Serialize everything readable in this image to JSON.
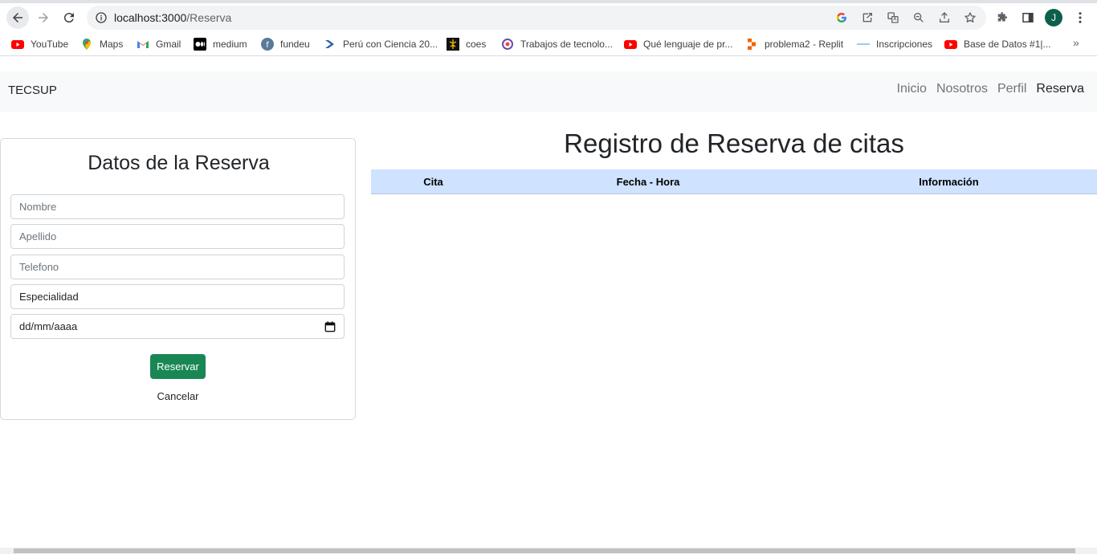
{
  "browser": {
    "url_host": "localhost:3000",
    "url_path": "/Reserva",
    "avatar_initial": "J",
    "bookmarks": [
      {
        "label": "YouTube",
        "icon": "youtube-icon"
      },
      {
        "label": "Maps",
        "icon": "maps-icon"
      },
      {
        "label": "Gmail",
        "icon": "gmail-icon"
      },
      {
        "label": "medium",
        "icon": "medium-icon"
      },
      {
        "label": "fundeu",
        "icon": "fundeu-icon"
      },
      {
        "label": "Perú con Ciencia 20...",
        "icon": "peru-ciencia-icon"
      },
      {
        "label": "coes",
        "icon": "coes-icon"
      },
      {
        "label": "Trabajos de tecnolo...",
        "icon": "trabajos-icon"
      },
      {
        "label": "Qué lenguaje de pr...",
        "icon": "youtube-icon"
      },
      {
        "label": "problema2 - Replit",
        "icon": "replit-icon"
      },
      {
        "label": "Inscripciones",
        "icon": "inscripciones-icon"
      },
      {
        "label": "Base de Datos #1|...",
        "icon": "youtube-icon"
      }
    ],
    "more_label": "»"
  },
  "navbar": {
    "brand": "TECSUP",
    "links": [
      {
        "label": "Inicio",
        "active": false
      },
      {
        "label": "Nosotros",
        "active": false
      },
      {
        "label": "Perfil",
        "active": false
      },
      {
        "label": "Reserva",
        "active": true
      }
    ]
  },
  "form": {
    "title": "Datos de la Reserva",
    "nombre_placeholder": "Nombre",
    "apellido_placeholder": "Apellido",
    "telefono_placeholder": "Telefono",
    "especialidad_value": "Especialidad",
    "fecha_placeholder": "dd/mm/aaaa",
    "submit_label": "Reservar",
    "cancel_label": "Cancelar"
  },
  "registro": {
    "title": "Registro de Reserva de citas",
    "columns": [
      "Cita",
      "Fecha - Hora",
      "Información"
    ],
    "rows": []
  },
  "colors": {
    "success": "#198754",
    "table_head": "#cfe2ff",
    "navbar_bg": "#f8f9fa"
  }
}
